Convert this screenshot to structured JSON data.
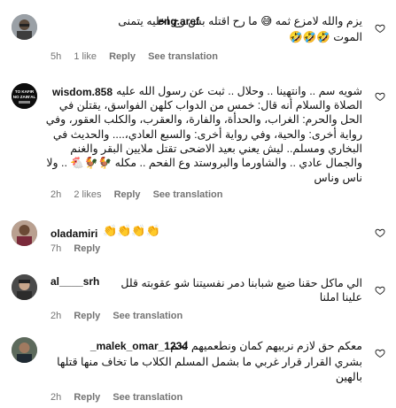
{
  "comments": [
    {
      "username": "eng.aref",
      "lines": [
        "يزم والله لامزع ثمه 😅 ما رح اقتله بس رح اخليه يتمنى",
        "الموت 🤣🤣🤣"
      ],
      "time": "5h",
      "likes": "1 like",
      "reply": "Reply",
      "translate": "See translation"
    },
    {
      "username": "wisdom.858",
      "lines": [
        "شويه سم .. وانتهينا .. وحلال .. ثبت عن رسول الله عليه",
        "الصلاة والسلام أنه قال: خمس من الدواب كلهن الفواسق، يقتلن في",
        "الحل والحرم: الغراب، والحدأة، والفارة، والعقرب، والكلب العقور، وفي",
        "رواية أخرى: والحية، وفي رواية أخرى: والسبع العادي،.... والحديث في",
        "البخاري ومسلم.. ليش يعني بعيد الاضحى تقتل ملايين البقر والغنم",
        "والجمال عادي .. والشاورما والبروستد وع الفحم .. مكله 🐓🐓🐔 .. ولا",
        "ناس وناس"
      ],
      "time": "2h",
      "likes": "2 likes",
      "reply": "Reply",
      "translate": "See translation"
    },
    {
      "username": "oladamiri",
      "emojis": "👏👏👏👏",
      "time": "7h",
      "reply": "Reply"
    },
    {
      "username": "al____srh",
      "lines": [
        "الي ماكل حقنا ضيع شبابنا دمر نفسيتنا شو عقوبته قلل",
        "علينا املنا"
      ],
      "time": "2h",
      "reply": "Reply",
      "translate": "See translation"
    },
    {
      "username": "_malek_omar_1234",
      "lines": [
        "معكم حق لازم نربيهم كمان ونطعميهم لحم",
        "بشري القرار قرار غربي ما بشمل المسلم الكلاب ما تخاف منها قتلها",
        "بالهين"
      ],
      "time": "2h",
      "reply": "Reply",
      "translate": "See translation"
    }
  ],
  "icons": {
    "like": "heart-outline-icon",
    "wisdom_avatar_text": "TO KAFIR NO ZAIN'AL"
  },
  "colors": {
    "meta": "#737373",
    "text": "#111111",
    "background": "#ffffff"
  }
}
